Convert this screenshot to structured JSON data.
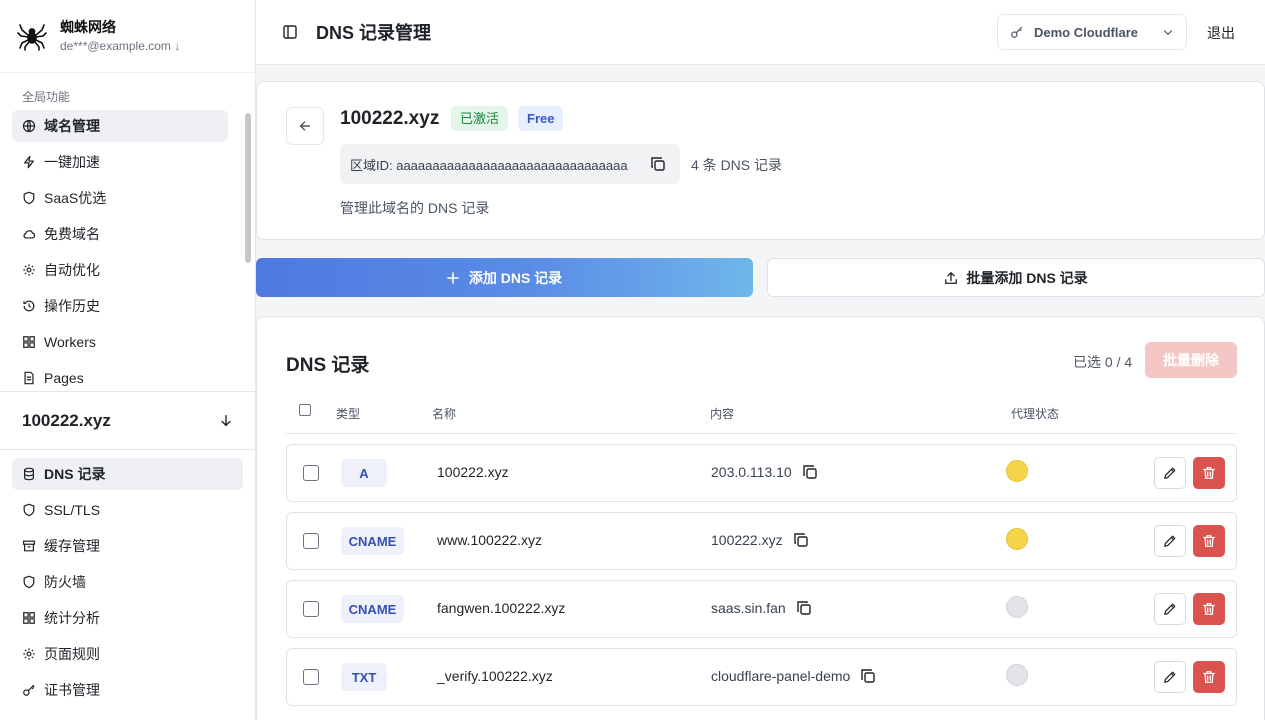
{
  "brand": {
    "name": "蜘蛛网络",
    "email": "de***@example.com"
  },
  "sidebar": {
    "global_label": "全局功能",
    "global_items": [
      {
        "label": "域名管理",
        "icon": "globe-icon",
        "active": true
      },
      {
        "label": "一键加速",
        "icon": "bolt-icon"
      },
      {
        "label": "SaaS优选",
        "icon": "shield-icon"
      },
      {
        "label": "免费域名",
        "icon": "cloud-icon"
      },
      {
        "label": "自动优化",
        "icon": "gear-icon"
      },
      {
        "label": "操作历史",
        "icon": "history-icon"
      },
      {
        "label": "Workers",
        "icon": "grid-icon"
      },
      {
        "label": "Pages",
        "icon": "file-icon"
      }
    ],
    "current_domain": "100222.xyz",
    "domain_items": [
      {
        "label": "DNS 记录",
        "icon": "database-icon",
        "active": true
      },
      {
        "label": "SSL/TLS",
        "icon": "shield-icon"
      },
      {
        "label": "缓存管理",
        "icon": "archive-icon"
      },
      {
        "label": "防火墙",
        "icon": "shield-icon"
      },
      {
        "label": "统计分析",
        "icon": "grid-icon"
      },
      {
        "label": "页面规则",
        "icon": "gear-icon"
      },
      {
        "label": "证书管理",
        "icon": "key-icon"
      }
    ]
  },
  "header": {
    "title": "DNS 记录管理",
    "account": "Demo Cloudflare",
    "logout": "退出"
  },
  "zone": {
    "name": "100222.xyz",
    "status": "已激活",
    "plan": "Free",
    "zone_id_label": "区域ID: aaaaaaaaaaaaaaaaaaaaaaaaaaaaaaaa",
    "record_count": "4 条 DNS 记录",
    "description": "管理此域名的 DNS 记录"
  },
  "actions": {
    "add": "添加 DNS 记录",
    "bulk_add": "批量添加 DNS 记录"
  },
  "records": {
    "title": "DNS 记录",
    "selected": "已选 0 / 4",
    "batch_delete": "批量删除",
    "columns": {
      "type": "类型",
      "name": "名称",
      "content": "内容",
      "proxy": "代理状态"
    },
    "rows": [
      {
        "type": "A",
        "name": "100222.xyz",
        "content": "203.0.113.10",
        "proxied": true
      },
      {
        "type": "CNAME",
        "name": "www.100222.xyz",
        "content": "100222.xyz",
        "proxied": true
      },
      {
        "type": "CNAME",
        "name": "fangwen.100222.xyz",
        "content": "saas.sin.fan",
        "proxied": false
      },
      {
        "type": "TXT",
        "name": "_verify.100222.xyz",
        "content": "cloudflare-panel-demo",
        "proxied": false
      }
    ]
  },
  "colors": {
    "primary": "#4f79e0",
    "danger": "#d9534f",
    "proxy_on": "#f5d547",
    "active_badge": "#1c8a3d"
  }
}
